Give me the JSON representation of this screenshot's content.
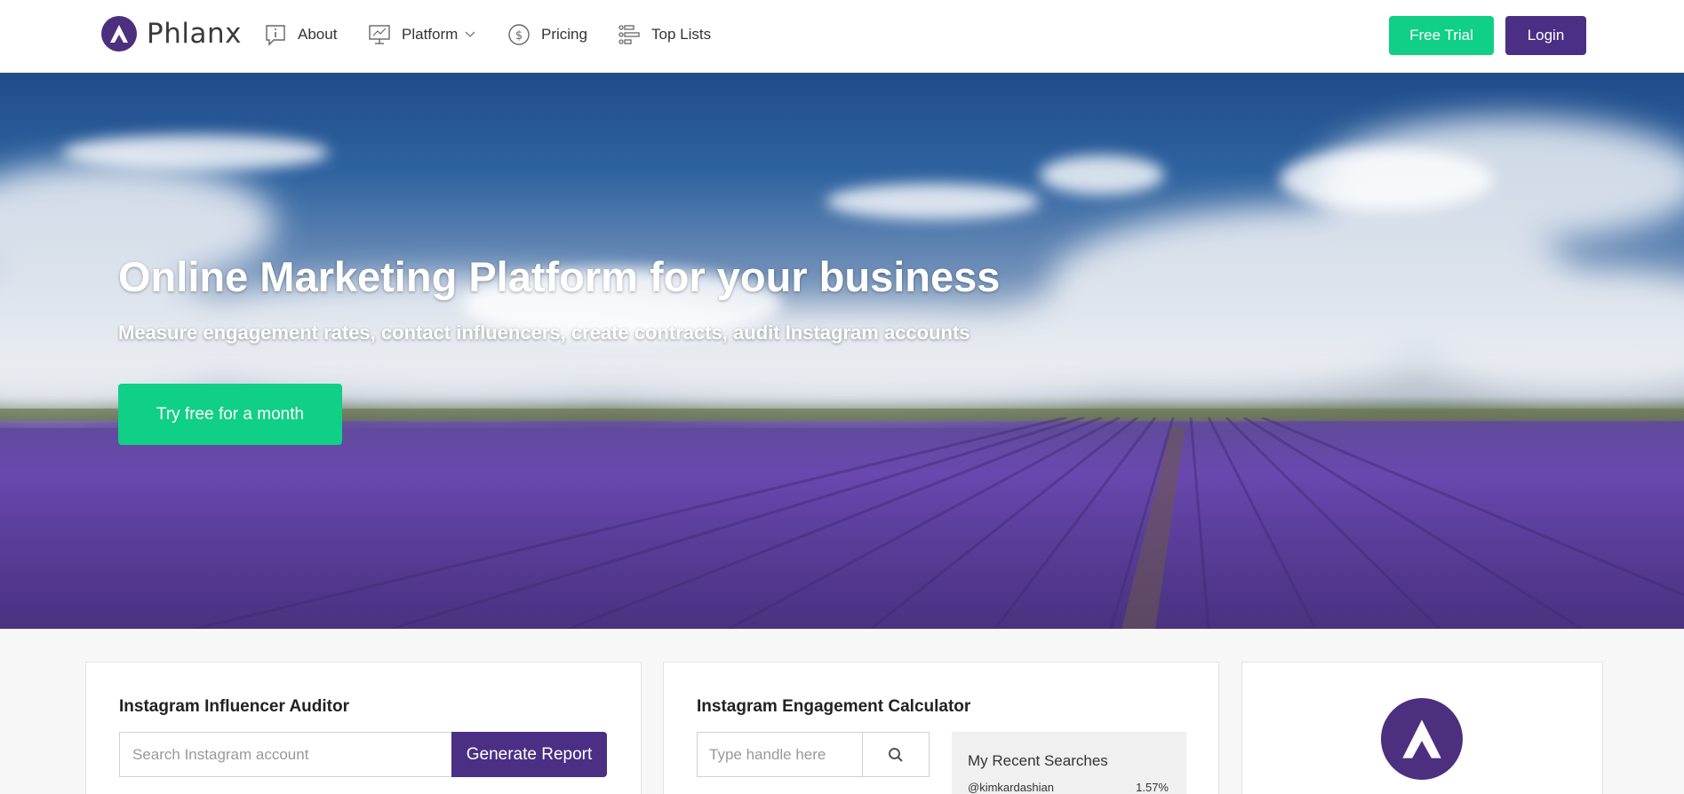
{
  "brand": {
    "name": "Phlanx",
    "logo_icon": "phlanx-logo-icon",
    "accent": "#4b2f84"
  },
  "nav": {
    "items": [
      {
        "label": "About",
        "icon": "info-bubble-icon"
      },
      {
        "label": "Platform",
        "icon": "monitor-icon",
        "has_dropdown": true
      },
      {
        "label": "Pricing",
        "icon": "dollar-circle-icon"
      },
      {
        "label": "Top Lists",
        "icon": "list-bars-icon"
      }
    ],
    "free_trial_label": "Free Trial",
    "login_label": "Login",
    "trial_color": "#10cf86"
  },
  "hero": {
    "title": "Online Marketing Platform for your business",
    "subtitle": "Measure engagement rates, contact influencers, create contracts, audit Instagram accounts",
    "cta_label": "Try free for a month"
  },
  "auditor": {
    "title": "Instagram Influencer Auditor",
    "placeholder": "Search Instagram account",
    "button_label": "Generate Report"
  },
  "engagement": {
    "title": "Instagram Engagement Calculator",
    "placeholder": "Type handle here",
    "search_icon": "search-icon",
    "recent_title": "My Recent Searches",
    "recent": [
      {
        "handle": "@kimkardashian",
        "rate": "1.57%"
      }
    ]
  }
}
